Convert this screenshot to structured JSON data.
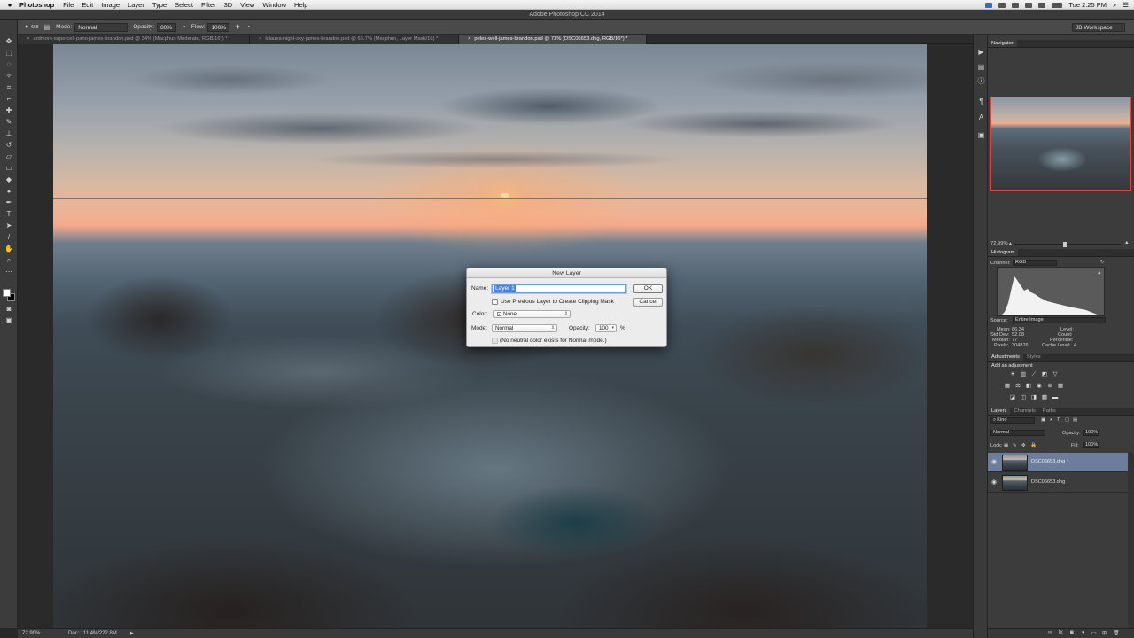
{
  "menubar": {
    "apple": "",
    "app_name": "Photoshop",
    "items": [
      "File",
      "Edit",
      "Image",
      "Layer",
      "Type",
      "Select",
      "Filter",
      "3D",
      "View",
      "Window",
      "Help"
    ],
    "clock": "Tue 2:25 PM"
  },
  "window": {
    "title": "Adobe Photoshop CC 2014"
  },
  "options_bar": {
    "brush_size": "668",
    "mode_label": "Mode:",
    "mode_value": "Normal",
    "opacity_label": "Opacity:",
    "opacity_value": "80%",
    "flow_label": "Flow:",
    "flow_value": "100%",
    "workspace": "JB Workspace"
  },
  "tabs": [
    {
      "label": "ardmore-supercell-pano-james-brandon.psd @ 34% (Macphun Moderate, RGB/16*) *",
      "active": false
    },
    {
      "label": "kilauea-night-sky-james-brandon.psd @ 66.7% (Macphun, Layer Mask/16) *",
      "active": false
    },
    {
      "label": "peles-well-james-brandon.psd @ 73% (DSC06653.dng, RGB/16*) *",
      "active": true
    }
  ],
  "dialog": {
    "title": "New Layer",
    "name_label": "Name:",
    "name_value": "Layer 1",
    "ok_label": "OK",
    "cancel_label": "Cancel",
    "clipping_label": "Use Previous Layer to Create Clipping Mask",
    "color_label": "Color:",
    "color_value": "None",
    "mode_label": "Mode:",
    "mode_value": "Normal",
    "opacity_label": "Opacity:",
    "opacity_value": "100",
    "percent": "%",
    "neutral_label": "(No neutral color exists for Normal mode.)"
  },
  "status_bar": {
    "zoom": "72.99%",
    "doc": "Doc: 111.4M/222.8M"
  },
  "navigator": {
    "tab": "Navigator",
    "zoom": "72.99%"
  },
  "histogram": {
    "tab": "Histogram",
    "channel_label": "Channel:",
    "channel_value": "RGB",
    "source_label": "Source:",
    "source_value": "Entire Image",
    "mean_label": "Mean:",
    "mean_value": "86.34",
    "stddev_label": "Std Dev:",
    "stddev_value": "52.08",
    "median_label": "Median:",
    "median_value": "77",
    "pixels_label": "Pixels:",
    "pixels_value": "304876",
    "level_label": "Level:",
    "count_label": "Count:",
    "percentile_label": "Percentile:",
    "cache_label": "Cache Level:",
    "cache_value": "4"
  },
  "adjustments": {
    "tabs": [
      "Adjustments",
      "Styles"
    ],
    "title": "Add an adjustment"
  },
  "layers": {
    "tabs": [
      "Layers",
      "Channels",
      "Paths"
    ],
    "kind": "Kind",
    "blend_mode": "Normal",
    "opacity_label": "Opacity:",
    "opacity_value": "100%",
    "lock_label": "Lock:",
    "fill_label": "Fill:",
    "fill_value": "100%",
    "rows": [
      {
        "name": "DSC06653.dng",
        "selected": true
      },
      {
        "name": "DSC06653.dng",
        "selected": false
      }
    ]
  }
}
